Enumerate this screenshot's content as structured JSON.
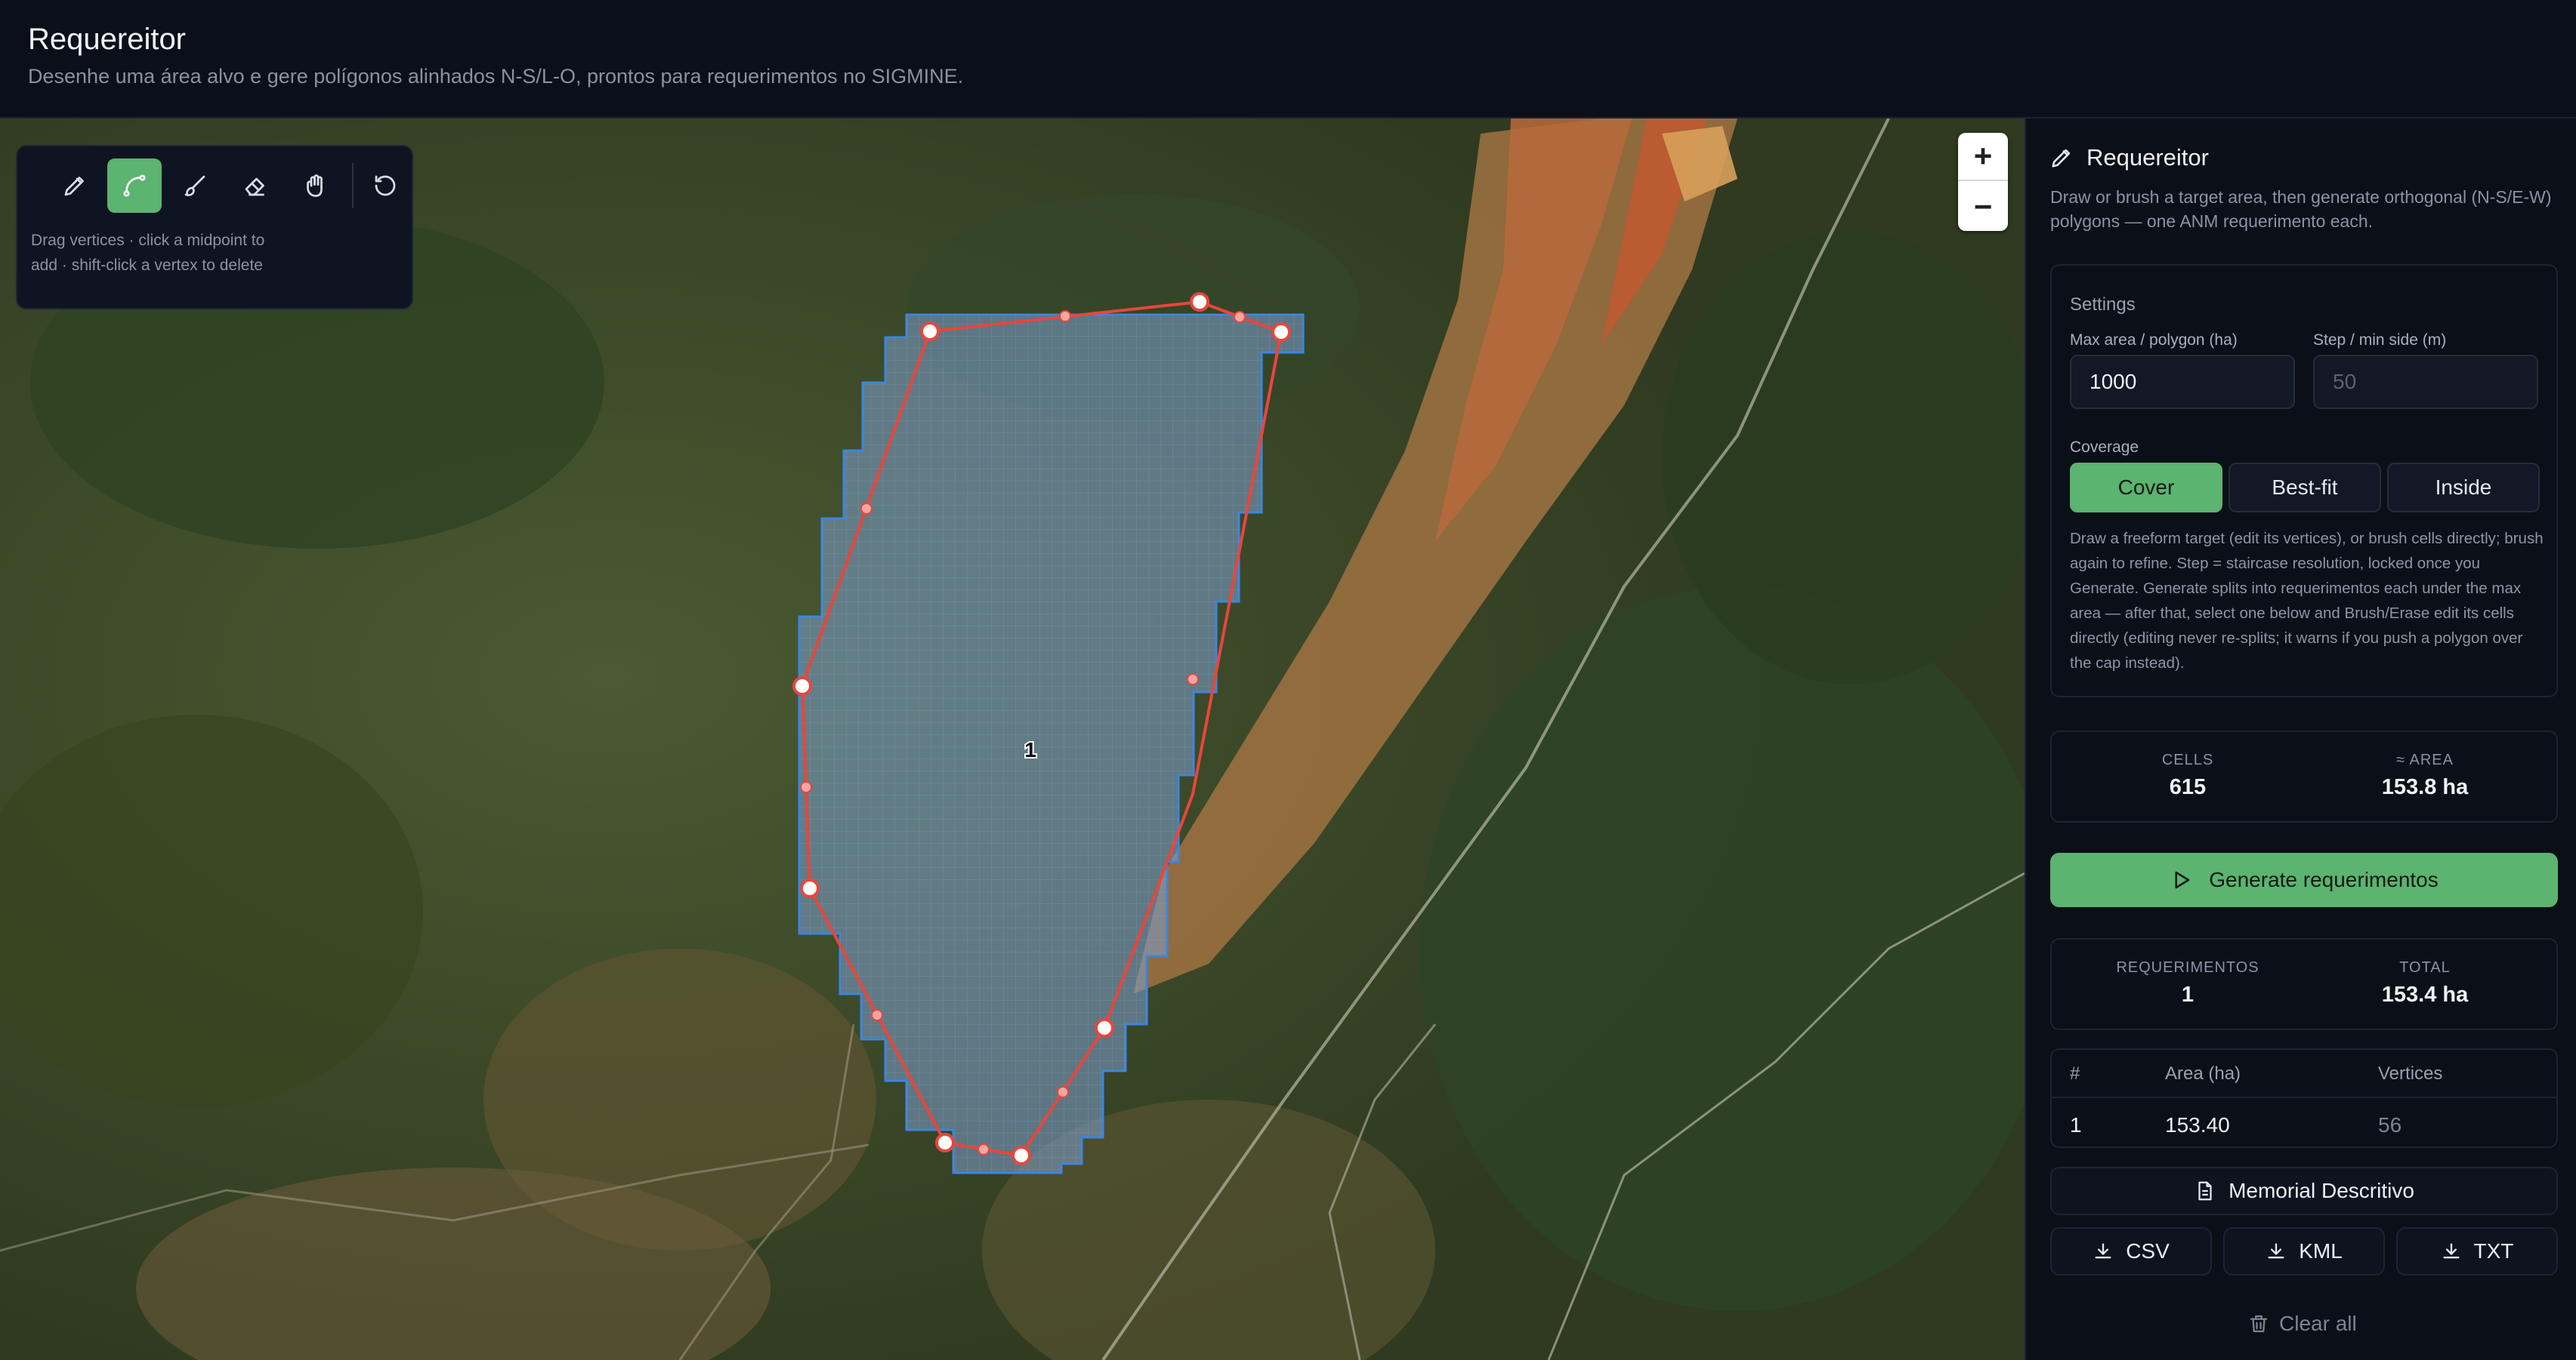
{
  "header": {
    "title": "Requereitor",
    "subtitle": "Desenhe uma área alvo e gere polígonos alinhados N-S/L-O, prontos para requerimentos no SIGMINE."
  },
  "toolbar": {
    "tools": [
      {
        "icon": "pencil-icon",
        "active": false
      },
      {
        "icon": "curve-path-icon",
        "active": true
      },
      {
        "icon": "brush-icon",
        "active": false
      },
      {
        "icon": "eraser-icon",
        "active": false
      },
      {
        "icon": "hand-icon",
        "active": false
      },
      {
        "icon": "undo-icon",
        "active": false
      }
    ],
    "hint": "Drag vertices · click a midpoint to add · shift-click a vertex to delete"
  },
  "map": {
    "zoom_in": "+",
    "zoom_out": "−",
    "polygon_label": "1"
  },
  "panel": {
    "title": "Requereitor",
    "description": "Draw or brush a target area, then generate orthogonal (N-S/E-W) polygons — one ANM requerimento each.",
    "settings": {
      "label": "Settings",
      "max_area_label": "Max area / polygon (ha)",
      "max_area_value": "1000",
      "step_label": "Step / min side (m)",
      "step_placeholder": "50",
      "coverage_label": "Coverage",
      "coverage_options": [
        "Cover",
        "Best-fit",
        "Inside"
      ],
      "coverage_selected": "Cover",
      "help": "Draw a freeform target (edit its vertices), or brush cells directly; brush again to refine. Step = staircase resolution, locked once you Generate. Generate splits into requerimentos each under the max area — after that, select one below and Brush/Erase edit its cells directly (editing never re-splits; it warns if you push a polygon over the cap instead)."
    },
    "stats": {
      "cells_label": "CELLS",
      "cells_value": "615",
      "area_label": "≈ AREA",
      "area_value": "153.8 ha"
    },
    "generate_label": "Generate requerimentos",
    "results": {
      "req_label": "REQUERIMENTOS",
      "req_value": "1",
      "total_label": "TOTAL",
      "total_value": "153.4 ha"
    },
    "table": {
      "headers": [
        "#",
        "Area (ha)",
        "Vertices"
      ],
      "rows": [
        [
          "1",
          "153.40",
          "56"
        ]
      ]
    },
    "memorial_label": "Memorial Descritivo",
    "exports": [
      "CSV",
      "KML",
      "TXT"
    ],
    "clear_label": "Clear all"
  },
  "colors": {
    "accent": "#5bb46f",
    "polygon_stroke": "#e8463c",
    "cells_stroke": "#3b86e0",
    "background": "#0b0f18"
  }
}
